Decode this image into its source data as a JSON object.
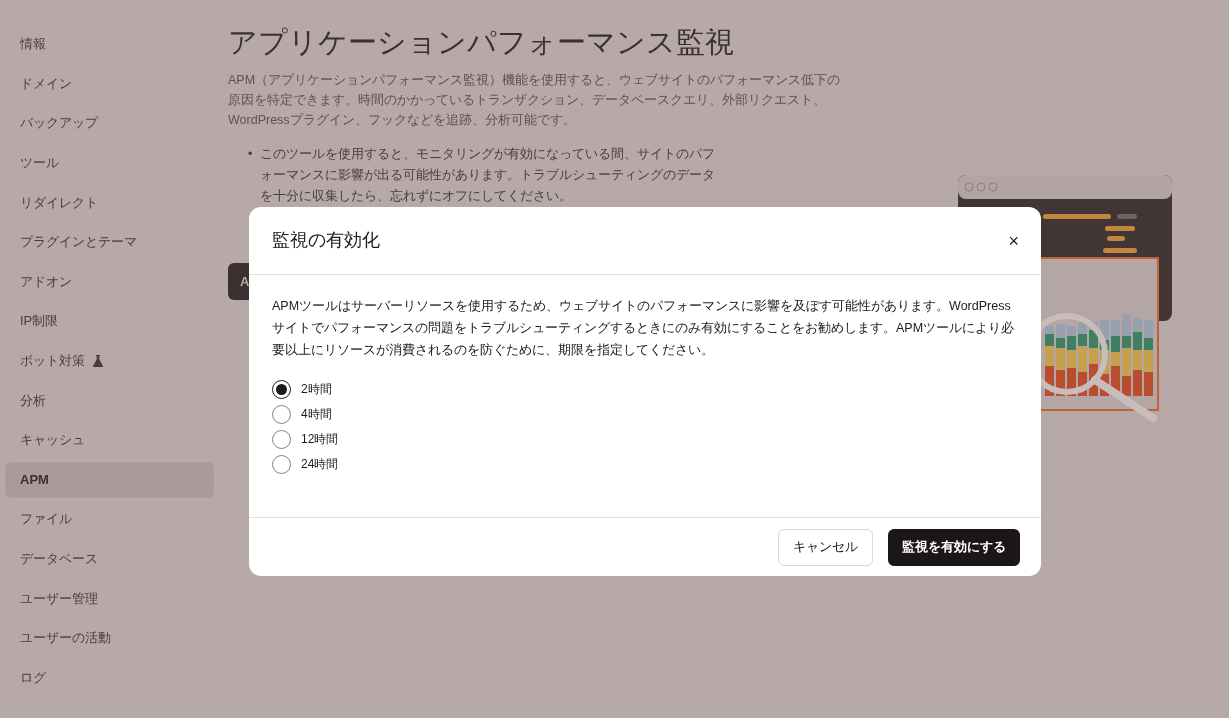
{
  "sidebar": {
    "items": [
      {
        "label": "情報",
        "selected": false,
        "kind": "link"
      },
      {
        "label": "ドメイン",
        "selected": false,
        "kind": "link"
      },
      {
        "label": "バックアップ",
        "selected": false,
        "kind": "link"
      },
      {
        "label": "ツール",
        "selected": false,
        "kind": "link"
      },
      {
        "label": "リダイレクト",
        "selected": false,
        "kind": "link"
      },
      {
        "label": "プラグインとテーマ",
        "selected": false,
        "kind": "link"
      },
      {
        "label": "アドオン",
        "selected": false,
        "kind": "link"
      },
      {
        "label": "IP制限",
        "selected": false,
        "kind": "link"
      },
      {
        "label": "ボット対策",
        "selected": false,
        "kind": "labs"
      },
      {
        "label": "分析",
        "selected": false,
        "kind": "link"
      },
      {
        "label": "キャッシュ",
        "selected": false,
        "kind": "link"
      },
      {
        "label": "APM",
        "selected": true,
        "kind": "link"
      },
      {
        "label": "ファイル",
        "selected": false,
        "kind": "link"
      },
      {
        "label": "データベース",
        "selected": false,
        "kind": "link"
      },
      {
        "label": "ユーザー管理",
        "selected": false,
        "kind": "link"
      },
      {
        "label": "ユーザーの活動",
        "selected": false,
        "kind": "link"
      },
      {
        "label": "ログ",
        "selected": false,
        "kind": "link"
      }
    ]
  },
  "page": {
    "title": "アプリケーションパフォーマンス監視",
    "description": "APM（アプリケーションパフォーマンス監視）機能を使用すると、ウェブサイトのパフォーマンス低下の原因を特定できます。時間のかかっているトランザクション、データベースクエリ、外部リクエスト、WordPressプラグイン、フックなどを追跡、分析可能です。",
    "bullets": [
      {
        "marker": "•",
        "text": "このツールを使用すると、モニタリングが有効になっている間、サイトのパフォーマンスに影響が出る可能性があります。トラブルシューティングのデータを十分に収集したら、忘れずにオフにしてください。"
      }
    ],
    "button": "A"
  },
  "dialog": {
    "title": "監視の有効化",
    "close": "×",
    "message": "APMツールはサーバーリソースを使用するため、ウェブサイトのパフォーマンスに影響を及ぼす可能性があります。WordPressサイトでパフォーマンスの問題をトラブルシューティングするときにのみ有効にすることをお勧めします。APMツールにより必要以上にリソースが消費されるのを防ぐために、期限を指定してください。",
    "options": [
      {
        "label": "2時間",
        "selected": true
      },
      {
        "label": "4時間",
        "selected": false
      },
      {
        "label": "12時間",
        "selected": false
      },
      {
        "label": "24時間",
        "selected": false
      }
    ],
    "buttons": [
      {
        "label": "キャンセル",
        "kind": "secondary"
      },
      {
        "label": "監視を有効にする",
        "kind": "primary"
      }
    ]
  }
}
